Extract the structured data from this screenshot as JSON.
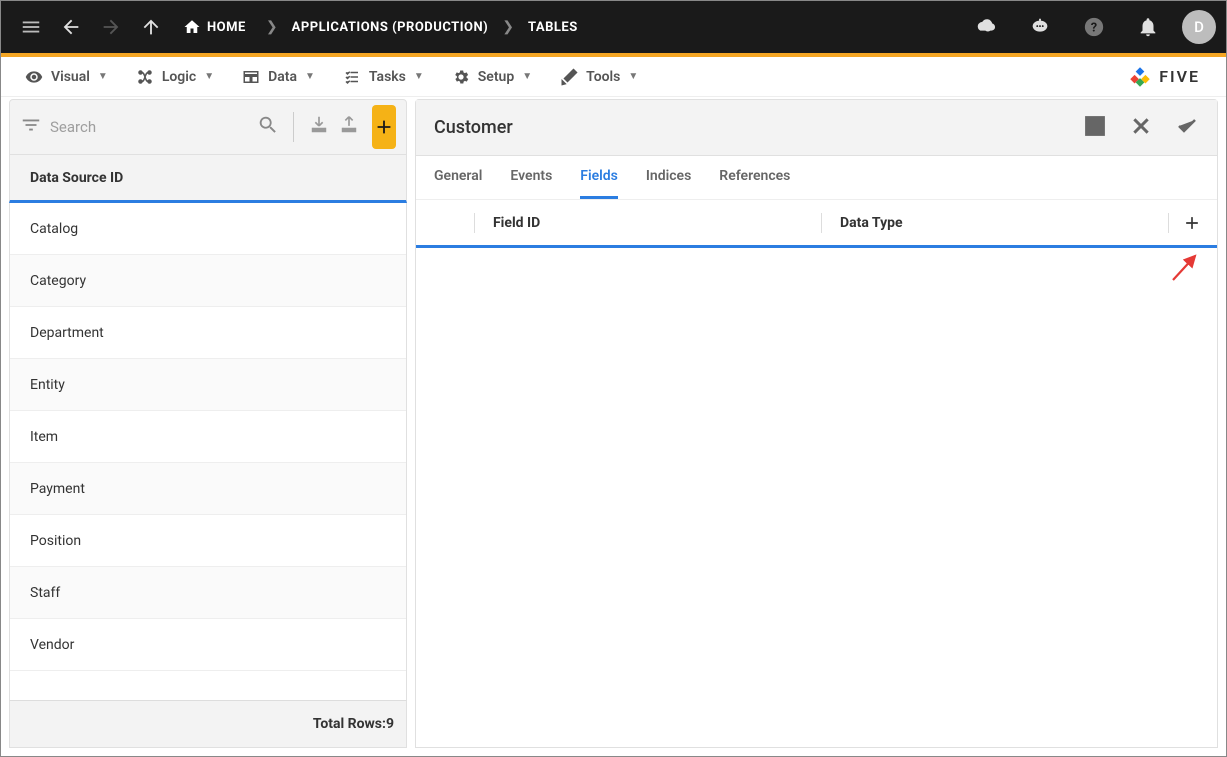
{
  "topbar": {
    "breadcrumbs": {
      "home": "HOME",
      "app": "APPLICATIONS (PRODUCTION)",
      "page": "TABLES"
    },
    "avatar_initial": "D"
  },
  "menubar": {
    "items": [
      {
        "label": "Visual"
      },
      {
        "label": "Logic"
      },
      {
        "label": "Data"
      },
      {
        "label": "Tasks"
      },
      {
        "label": "Setup"
      },
      {
        "label": "Tools"
      }
    ],
    "brand": "FIVE"
  },
  "sidebar": {
    "search_placeholder": "Search",
    "header": "Data Source ID",
    "rows": [
      "Catalog",
      "Category",
      "Department",
      "Entity",
      "Item",
      "Payment",
      "Position",
      "Staff",
      "Vendor"
    ],
    "footer_label": "Total Rows: ",
    "footer_value": "9"
  },
  "main": {
    "title": "Customer",
    "tabs": [
      {
        "label": "General",
        "active": false
      },
      {
        "label": "Events",
        "active": false
      },
      {
        "label": "Fields",
        "active": true
      },
      {
        "label": "Indices",
        "active": false
      },
      {
        "label": "References",
        "active": false
      }
    ],
    "columns": {
      "field_id": "Field ID",
      "data_type": "Data Type"
    }
  }
}
